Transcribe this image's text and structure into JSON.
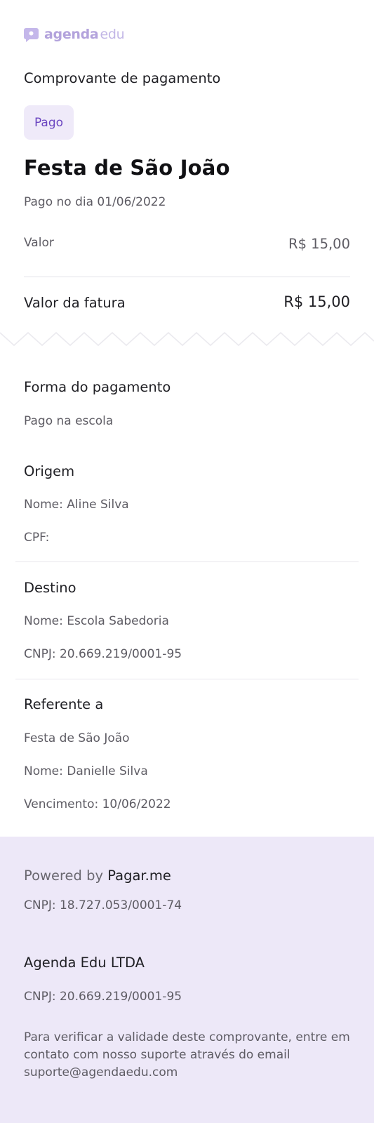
{
  "brand": {
    "logo_word1": "agenda",
    "logo_word2": "edu",
    "accent": "#6b46c1",
    "logo_color": "#b3a3dc"
  },
  "receipt": {
    "title": "Comprovante de pagamento",
    "status": "Pago",
    "event": "Festa de São João",
    "paid_on": "Pago no dia 01/06/2022",
    "value_label": "Valor",
    "value": "R$ 15,00",
    "total_label": "Valor da fatura",
    "total": "R$ 15,00"
  },
  "payment": {
    "title": "Forma do pagamento",
    "method": "Pago na escola"
  },
  "origin": {
    "title": "Origem",
    "name": "Nome: Aline Silva",
    "cpf": "CPF:"
  },
  "destination": {
    "title": "Destino",
    "name": "Nome: Escola Sabedoria",
    "cnpj": "CNPJ: 20.669.219/0001-95"
  },
  "reference": {
    "title": "Referente a",
    "event": "Festa de São João",
    "name": "Nome: Danielle Silva",
    "due": "Vencimento: 10/06/2022"
  },
  "footer": {
    "powered_prefix": "Powered by",
    "powered_brand": "Pagar.me",
    "processor_cnpj": "CNPJ: 18.727.053/0001-74",
    "company": "Agenda Edu LTDA",
    "company_cnpj": "CNPJ: 20.669.219/0001-95",
    "disclaimer": "Para verificar a validade deste comprovante, entre em contato com nosso suporte através do email suporte@agendaedu.com",
    "background": "#ede8f8"
  }
}
